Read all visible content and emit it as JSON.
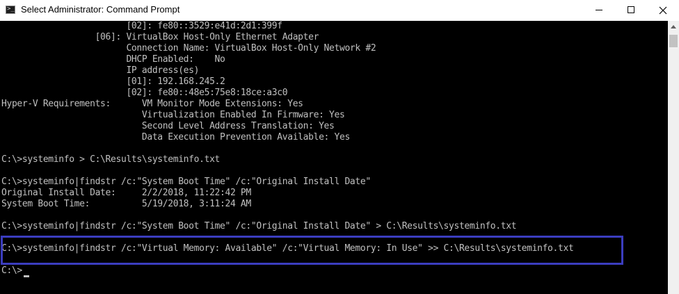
{
  "window": {
    "title": "Select Administrator: Command Prompt",
    "icon": "cmd-icon",
    "icon_glyph": ">_"
  },
  "controls": {
    "minimize": "minimize-icon",
    "maximize": "maximize-icon",
    "close": "close-icon"
  },
  "console": {
    "lines": [
      "                        [02]: fe80::3529:e41d:2d1:399f",
      "                  [06]: VirtualBox Host-Only Ethernet Adapter",
      "                        Connection Name: VirtualBox Host-Only Network #2",
      "                        DHCP Enabled:    No",
      "                        IP address(es)",
      "                        [01]: 192.168.245.2",
      "                        [02]: fe80::48e5:75e8:18ce:a3c0",
      "Hyper-V Requirements:      VM Monitor Mode Extensions: Yes",
      "                           Virtualization Enabled In Firmware: Yes",
      "                           Second Level Address Translation: Yes",
      "                           Data Execution Prevention Available: Yes",
      "",
      "C:\\>systeminfo > C:\\Results\\systeminfo.txt",
      "",
      "C:\\>systeminfo|findstr /c:\"System Boot Time\" /c:\"Original Install Date\"",
      "Original Install Date:     2/2/2018, 11:22:42 PM",
      "System Boot Time:          5/19/2018, 3:11:24 AM",
      "",
      "C:\\>systeminfo|findstr /c:\"System Boot Time\" /c:\"Original Install Date\" > C:\\Results\\systeminfo.txt",
      "",
      "C:\\>systeminfo|findstr /c:\"Virtual Memory: Available\" /c:\"Virtual Memory: In Use\" >> C:\\Results\\systeminfo.txt",
      "",
      "C:\\>"
    ]
  },
  "colors": {
    "console_bg": "#000000",
    "console_text": "#c0c0c0",
    "highlight_border": "#3b3dbf"
  }
}
